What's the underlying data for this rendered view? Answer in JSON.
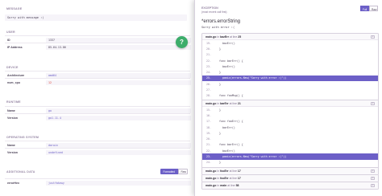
{
  "left": {
    "message_title": "MESSAGE",
    "message_value": "Sorry with message :(",
    "user": {
      "title": "USER",
      "rows": [
        {
          "key": "ID",
          "value": "1337"
        },
        {
          "key": "IP Address",
          "value": "85.64.13.86"
        }
      ]
    },
    "device": {
      "title": "DEVICE",
      "rows": [
        {
          "key": "Architecture",
          "value": "amd64"
        },
        {
          "key": "num_cpu",
          "value": "12"
        }
      ]
    },
    "runtime": {
      "title": "RUNTIME",
      "rows": [
        {
          "key": "Name",
          "value": "go"
        },
        {
          "key": "Version",
          "value": "go1.11.4"
        }
      ]
    },
    "os": {
      "title": "OPERATING SYSTEM",
      "rows": [
        {
          "key": "Name",
          "value": "darwin"
        },
        {
          "key": "Version",
          "value": "undefined"
        }
      ]
    },
    "additional": {
      "title": "ADDITIONAL DATA",
      "formatted_label": "Formatted",
      "raw_label": "Raw",
      "rows": [
        {
          "key": "errorHex",
          "value": "justfakewy"
        }
      ]
    },
    "fab_icon": "?"
  },
  "panel": {
    "section_title": "EXCEPTION",
    "most_recent": "(most recent call first)",
    "toggle_full": "Full",
    "toggle_raw": "Raw",
    "exception_type": "*errors.errorString",
    "exception_value": "Sorry with error :(",
    "frames": [
      {
        "file": "main.go",
        "in_word": "in",
        "func": "bazErr",
        "at_word": "at line",
        "line": "25",
        "code": [
          {
            "no": "19.",
            "text": "  bazErr()"
          },
          {
            "no": "20.",
            "text": "}"
          },
          {
            "no": "21.",
            "text": ""
          },
          {
            "no": "22.",
            "text": "func barErr() {"
          },
          {
            "no": "23.",
            "text": "  bazErr()"
          },
          {
            "no": "24.",
            "text": "}"
          },
          {
            "no": "25.",
            "text": "  panic(errors.New(",
            "str": "\"Sorry with error :(\"",
            "tail": "))",
            "active": true
          },
          {
            "no": "26.",
            "text": "}"
          },
          {
            "no": "27.",
            "text": ""
          },
          {
            "no": "28.",
            "text": "func fooMsg() {"
          },
          {
            "no": "29.",
            "text": "  barMsg()"
          },
          {
            "no": "30.",
            "text": "}"
          }
        ]
      },
      {
        "file": "main.go",
        "in_word": "in",
        "func": "barErr",
        "at_word": "at line",
        "line": "21",
        "code": [
          {
            "no": "15.",
            "text": "}"
          },
          {
            "no": "16.",
            "text": ""
          },
          {
            "no": "17.",
            "text": "func fooErr() {"
          },
          {
            "no": "18.",
            "text": "  barErr()"
          },
          {
            "no": "19.",
            "text": "}"
          },
          {
            "no": "20.",
            "text": ""
          },
          {
            "no": "21.",
            "text": "func barErr() {"
          },
          {
            "no": "22.",
            "text": "  bazErr()"
          },
          {
            "no": "23.",
            "text": "  panic(errors.New(",
            "str": "\"Sorry with error :(\"",
            "tail": "))",
            "active": true
          },
          {
            "no": "24.",
            "text": "}"
          },
          {
            "no": "25.",
            "text": ""
          }
        ]
      },
      {
        "file": "main.go",
        "in_word": "in",
        "func": "fooErr",
        "at_word": "at line",
        "line": "17",
        "code": []
      },
      {
        "file": "main.go",
        "in_word": "in",
        "func": "fooErr",
        "at_word": "at line",
        "line": "17",
        "code": []
      },
      {
        "file": "main.go",
        "in_word": "in",
        "func": "main",
        "at_word": "at line",
        "line": "58",
        "code": []
      }
    ],
    "expand_icon": "+"
  }
}
